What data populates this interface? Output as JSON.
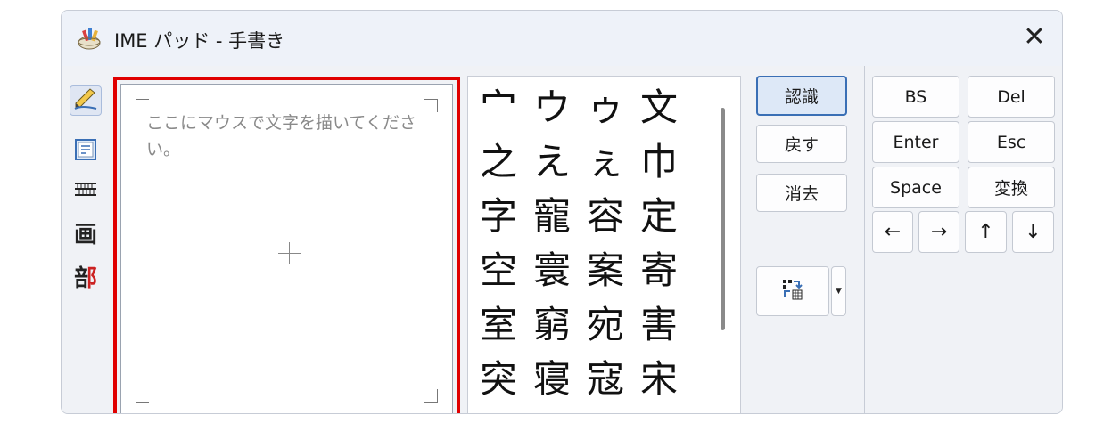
{
  "window": {
    "title": "IME パッド - 手書き",
    "close_label": "✕"
  },
  "toolbar": {
    "items": [
      {
        "name": "handwriting",
        "icon": "pencil-icon"
      },
      {
        "name": "character-list",
        "icon": "character-list-icon"
      },
      {
        "name": "soft-keyboard",
        "icon": "keyboard-icon"
      },
      {
        "name": "stroke-count",
        "label": "画"
      },
      {
        "name": "radical",
        "label": "部"
      }
    ]
  },
  "pad": {
    "placeholder": "ここにマウスで文字を描いてください。"
  },
  "candidates": {
    "rows": [
      [
        "宀",
        "ウ",
        "ゥ",
        "文"
      ],
      [
        "之",
        "え",
        "ぇ",
        "巾"
      ],
      [
        "字",
        "寵",
        "容",
        "定"
      ],
      [
        "空",
        "寰",
        "案",
        "寄"
      ],
      [
        "室",
        "窮",
        "宛",
        "害"
      ],
      [
        "突",
        "寝",
        "寇",
        "宋"
      ]
    ]
  },
  "actions": {
    "recognize": "認識",
    "undo": "戻す",
    "clear": "消去",
    "options_icon": "recognize-options-icon"
  },
  "keys": {
    "bs": "BS",
    "del": "Del",
    "enter": "Enter",
    "esc": "Esc",
    "space": "Space",
    "convert": "変換",
    "left": "←",
    "right": "→",
    "up": "↑",
    "down": "↓"
  },
  "colors": {
    "highlight": "#e00000",
    "accent": "#3a6fb5",
    "radical_red": "#cc2222"
  }
}
